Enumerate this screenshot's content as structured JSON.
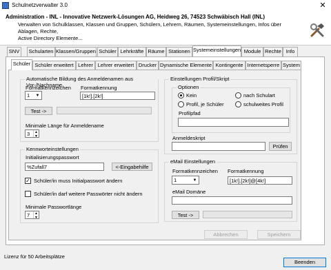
{
  "window": {
    "title": "Schulnetzverwalter 3.0",
    "close": "✕"
  },
  "header": {
    "title": "Administration - INL - Innovative Netzwerk-Lösungen AG, Heidweg 26, 74523 Schwäbisch Hall (INL)",
    "desc1": "Verwalten von Schulklassen, Klassen und Gruppen, Schülern, Lehrern, Räumen, Systemeinstellungen, Infos über Ablagen, Rechte,",
    "desc2": "Active Directory Elemente..."
  },
  "top_tabs": [
    "SNV",
    "Schularten",
    "Klassen/Gruppen",
    "Schüler",
    "Lehrkräfte",
    "Räume",
    "Stationen",
    "Systemeinstellungen",
    "Module",
    "Rechte",
    "Info"
  ],
  "sub_tabs": [
    "Schüler",
    "Schüler erweitert",
    "Lehrer",
    "Lehrer erweitert",
    "Drucker",
    "Dynamische Elemente",
    "Kontingente",
    "Internetsperre",
    "System"
  ],
  "login": {
    "group": "Automatische Bildung des Anmeldenamen aus Vor-/Nachname",
    "format_label": "Formatkennzeichen",
    "format_value": "1",
    "pattern_label": "Formatkennung",
    "pattern_value": "[1k!].[2k!]",
    "test_button": "Test ->",
    "min_len_label": "Minimale Länge für Anmeldename",
    "min_len_value": "3"
  },
  "password": {
    "group": "Kennworteinstellungen",
    "init_label": "Initialisierungspasswort",
    "init_value": "%Zufall7",
    "help_button": "<-Eingabehilfe",
    "must_change_label": "Schüler/in muss Initialpasswort ändern",
    "must_change_checked": true,
    "no_change_label": "Schüler/in darf weitere Passwörter nicht ändern",
    "no_change_checked": false,
    "min_len_label": "Minimale Passwortlänge",
    "min_len_value": "7"
  },
  "profile": {
    "group": "Einstellungen Profil/Skript",
    "options_group": "Optionen",
    "opt_none": "Kein",
    "opt_school_type": "nach Schulart",
    "opt_per_student": "Profil, je Schüler",
    "opt_school_wide": "schulweites Profil",
    "path_label": "Profilpfad",
    "path_value": "",
    "script_label": "Anmeldeskript",
    "script_value": "",
    "check_button": "Prüfen"
  },
  "email": {
    "group": "eMail Einstellungen",
    "format_label": "Formatkennzeichen",
    "format_value": "1",
    "pattern_label": "Formatkennung",
    "pattern_value": "[1k!].[2k!]@[4k!]",
    "domain_label": "eMail Domäne",
    "domain_value": "",
    "test_button": "Test ->"
  },
  "actions": {
    "cancel": "Abbrechen",
    "save": "Speichern"
  },
  "status": {
    "license": "Lizenz für 50 Arbeitsplätze",
    "quit": "Beenden"
  }
}
